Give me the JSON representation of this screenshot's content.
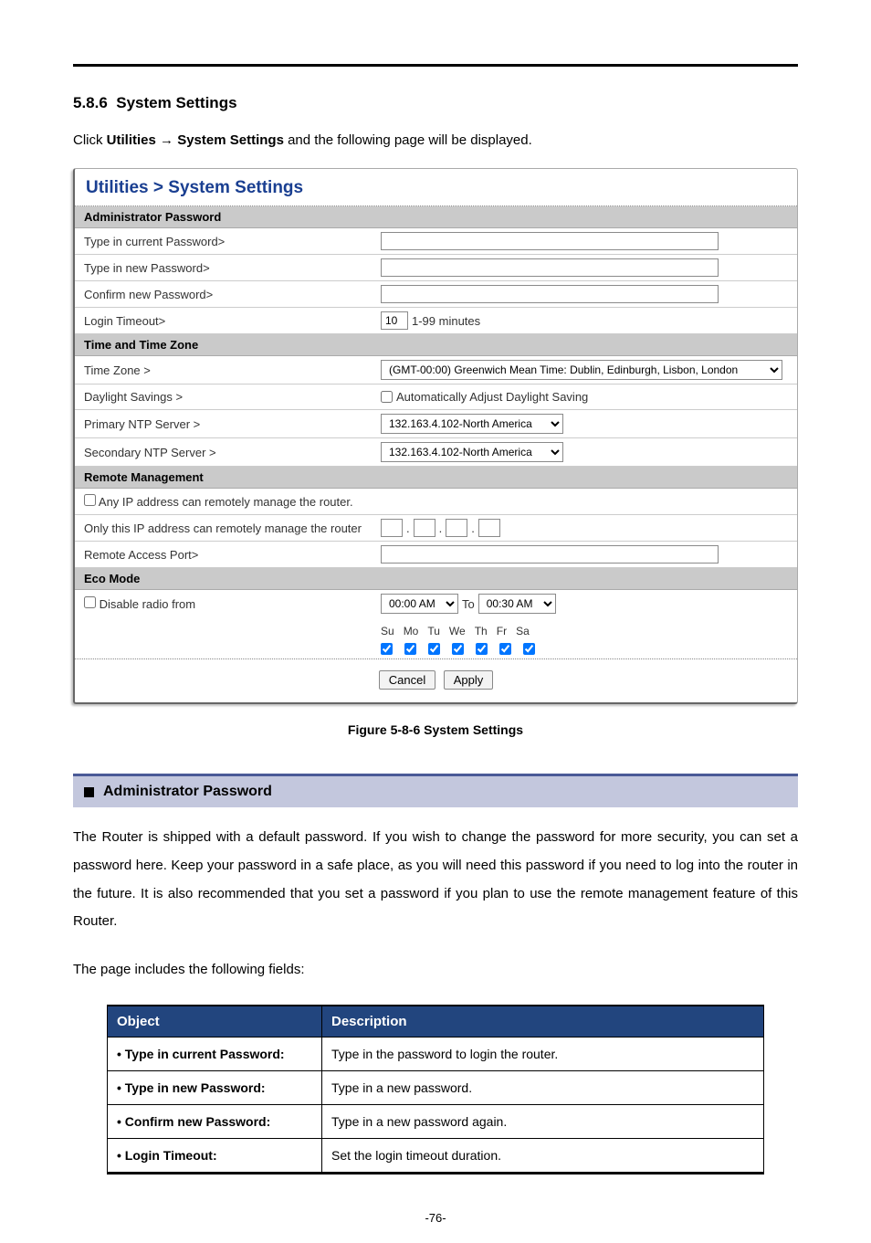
{
  "section_number": "5.8.6",
  "section_title": "System Settings",
  "intro_pre": "Click ",
  "intro_bold1": "Utilities",
  "intro_arrow": " → ",
  "intro_bold2": "System Settings",
  "intro_post": " and the following page will be displayed.",
  "breadcrumb": "Utilities > System Settings",
  "bands": {
    "admin": "Administrator Password",
    "time": "Time and Time Zone",
    "remote": "Remote Management",
    "eco": "Eco Mode"
  },
  "labels": {
    "curpw": "Type in current Password>",
    "newpw": "Type in new Password>",
    "confpw": "Confirm new Password>",
    "logintimeout": "Login Timeout>",
    "logintimeout_val": "10",
    "logintimeout_hint": "1-99 minutes",
    "tz": "Time Zone >",
    "tz_val": "(GMT-00:00) Greenwich Mean Time: Dublin, Edinburgh, Lisbon, London",
    "dst": "Daylight Savings >",
    "dst_cb": "Automatically Adjust Daylight Saving",
    "ntp1": "Primary NTP Server >",
    "ntp2": "Secondary NTP Server >",
    "ntp_val": "132.163.4.102-North America",
    "anyip": "Any IP address can remotely manage the router.",
    "onlyip": "Only this IP address can remotely manage the router",
    "raport": "Remote Access Port>",
    "disableradio": "Disable radio from",
    "towrd": "To",
    "time1": "00:00 AM",
    "time2": "00:30 AM",
    "days": [
      "Su",
      "Mo",
      "Tu",
      "We",
      "Th",
      "Fr",
      "Sa"
    ]
  },
  "buttons": {
    "cancel": "Cancel",
    "apply": "Apply"
  },
  "figure_caption": "Figure 5-8-6 System Settings",
  "subhead": "Administrator Password",
  "para1": "The Router is shipped with a default password. If you wish to change the password for more security, you can set a password here. Keep your password in a safe place, as you will need this password if you need to log into the router in the future. It is also recommended that you set a password if you plan to use the remote management feature of this Router.",
  "para2": "The page includes the following fields:",
  "table_head": {
    "obj": "Object",
    "desc": "Description"
  },
  "table_rows": [
    {
      "obj": "Type in current Password:",
      "desc": "Type in the password to login the router."
    },
    {
      "obj": "Type in new Password:",
      "desc": "Type in a new password."
    },
    {
      "obj": "Confirm new Password:",
      "desc": "Type in a new password again."
    },
    {
      "obj": "Login Timeout:",
      "desc": "Set the login timeout duration."
    }
  ],
  "page_number": "-76-"
}
